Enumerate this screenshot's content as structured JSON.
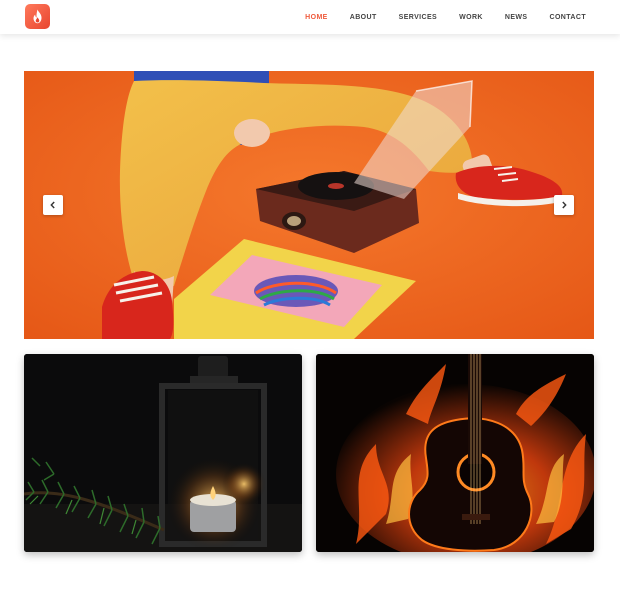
{
  "brand": {
    "logo_icon": "flame-icon",
    "accent": "#ef5a3c"
  },
  "nav": {
    "items": [
      {
        "label": "HOME",
        "active": true
      },
      {
        "label": "ABOUT",
        "active": false
      },
      {
        "label": "SERVICES",
        "active": false
      },
      {
        "label": "WORK",
        "active": false
      },
      {
        "label": "NEWS",
        "active": false
      },
      {
        "label": "CONTACT",
        "active": false
      }
    ]
  },
  "hero": {
    "image": "person-with-record-player-on-orange-background",
    "prev_icon": "chevron-left-icon",
    "next_icon": "chevron-right-icon"
  },
  "cards": [
    {
      "image": "lantern-with-candle-and-pine-branch"
    },
    {
      "image": "guitar-on-fire"
    }
  ]
}
